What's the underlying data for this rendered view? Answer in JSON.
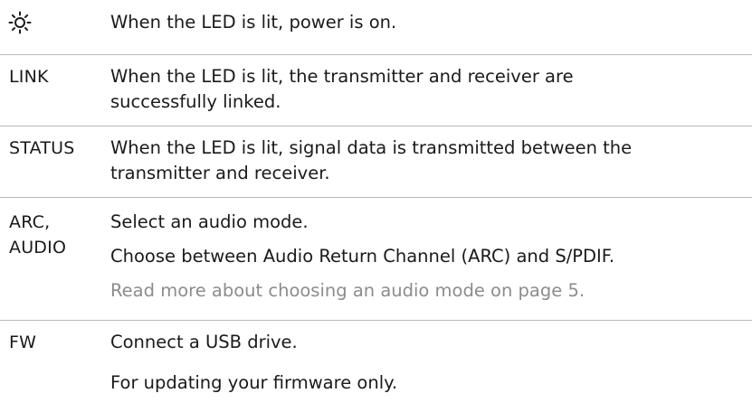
{
  "rows": [
    {
      "icon": "sun-icon",
      "description": "When the LED is lit, power is on."
    },
    {
      "label": "LINK",
      "description_lines": [
        "When the LED is lit, the transmitter and receiver are",
        "successfully linked."
      ]
    },
    {
      "label": "STATUS",
      "description_lines": [
        "When the LED is lit, signal data is transmitted between the",
        "transmitter and receiver."
      ]
    },
    {
      "label_lines": [
        "ARC,",
        "AUDIO"
      ],
      "paragraphs": [
        "Select an audio mode.",
        "Choose between Audio Return Channel (ARC) and S/PDIF.",
        "Read more about choosing an audio mode on page 5."
      ]
    },
    {
      "label": "FW",
      "paragraphs": [
        "Connect a USB drive.",
        "For updating your firmware only."
      ]
    }
  ],
  "colors": {
    "text": "#1a1a1a",
    "muted_text": "#8c8c8c",
    "divider": "#b8b8b8"
  }
}
